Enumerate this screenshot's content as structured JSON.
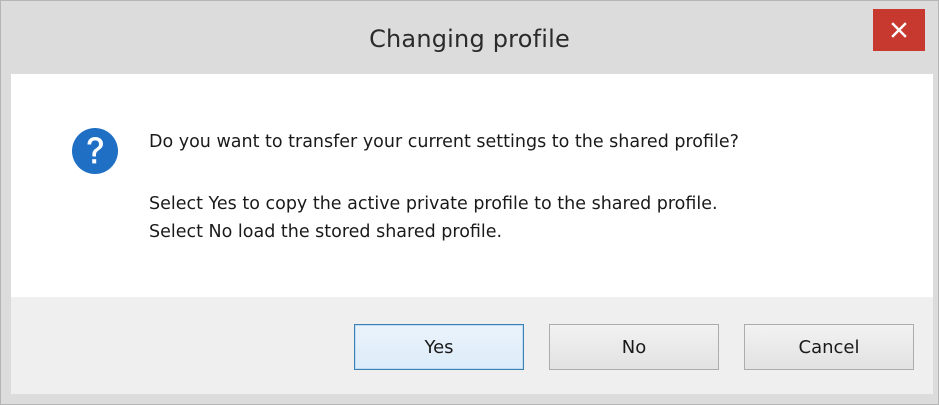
{
  "window": {
    "title": "Changing profile"
  },
  "icons": {
    "close": "close-icon",
    "question": "question-icon"
  },
  "message": {
    "main": "Do you want to transfer your current settings to the shared profile?",
    "line1": "Select Yes to copy the active private profile to the shared profile.",
    "line2": "Select No load the stored shared profile."
  },
  "buttons": {
    "yes": "Yes",
    "no": "No",
    "cancel": "Cancel"
  },
  "colors": {
    "close_bg": "#c7392f",
    "question_icon": "#1f6fc4",
    "default_button_border": "#3c7fb1"
  }
}
